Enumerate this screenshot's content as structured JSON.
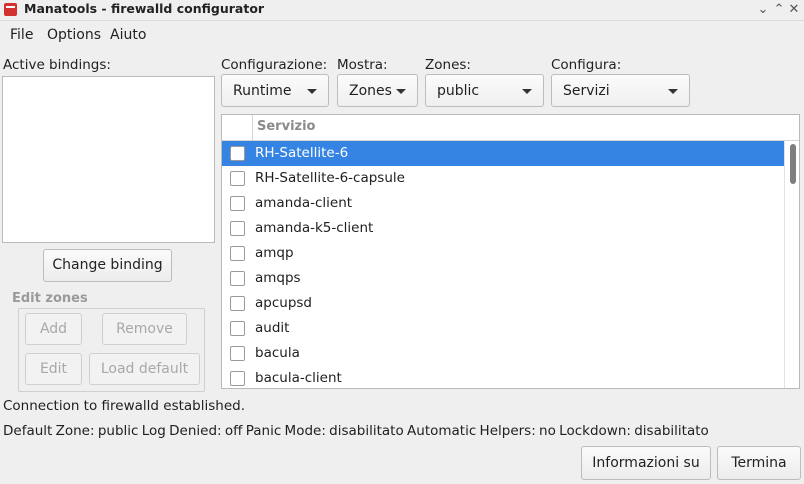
{
  "window": {
    "title": "Manatools - firewalld configurator",
    "controls": [
      "chevron-down-icon",
      "chevron-up-icon",
      "close-icon"
    ]
  },
  "menu": [
    "File",
    "Options",
    "Aiuto"
  ],
  "left": {
    "active_bindings_label": "Active bindings:",
    "change_binding": "Change binding",
    "edit_zones_label": "Edit zones",
    "add": "Add",
    "remove": "Remove",
    "edit": "Edit",
    "load_default": "Load default"
  },
  "filters": {
    "config": {
      "label": "Configurazione:",
      "value": "Runtime"
    },
    "show": {
      "label": "Mostra:",
      "value": "Zones"
    },
    "zones": {
      "label": "Zones:",
      "value": "public"
    },
    "configure": {
      "label": "Configura:",
      "value": "Servizi"
    }
  },
  "table": {
    "header": "Servizio",
    "rows": [
      {
        "name": "RH-Satellite-6",
        "checked": false,
        "selected": true
      },
      {
        "name": "RH-Satellite-6-capsule",
        "checked": false
      },
      {
        "name": "amanda-client",
        "checked": false
      },
      {
        "name": "amanda-k5-client",
        "checked": false
      },
      {
        "name": "amqp",
        "checked": false
      },
      {
        "name": "amqps",
        "checked": false
      },
      {
        "name": "apcupsd",
        "checked": false
      },
      {
        "name": "audit",
        "checked": false
      },
      {
        "name": "bacula",
        "checked": false
      },
      {
        "name": "bacula-client",
        "checked": false
      }
    ]
  },
  "status": {
    "connection": "Connection to firewalld established.",
    "info": "Default Zone: public  Log Denied: off  Panic Mode: disabilitato  Automatic Helpers: no  Lockdown: disabilitato"
  },
  "buttons": {
    "about": "Informazioni su",
    "quit": "Termina"
  },
  "colors": {
    "selection": "#3584e4",
    "app_icon": "#d43131"
  }
}
